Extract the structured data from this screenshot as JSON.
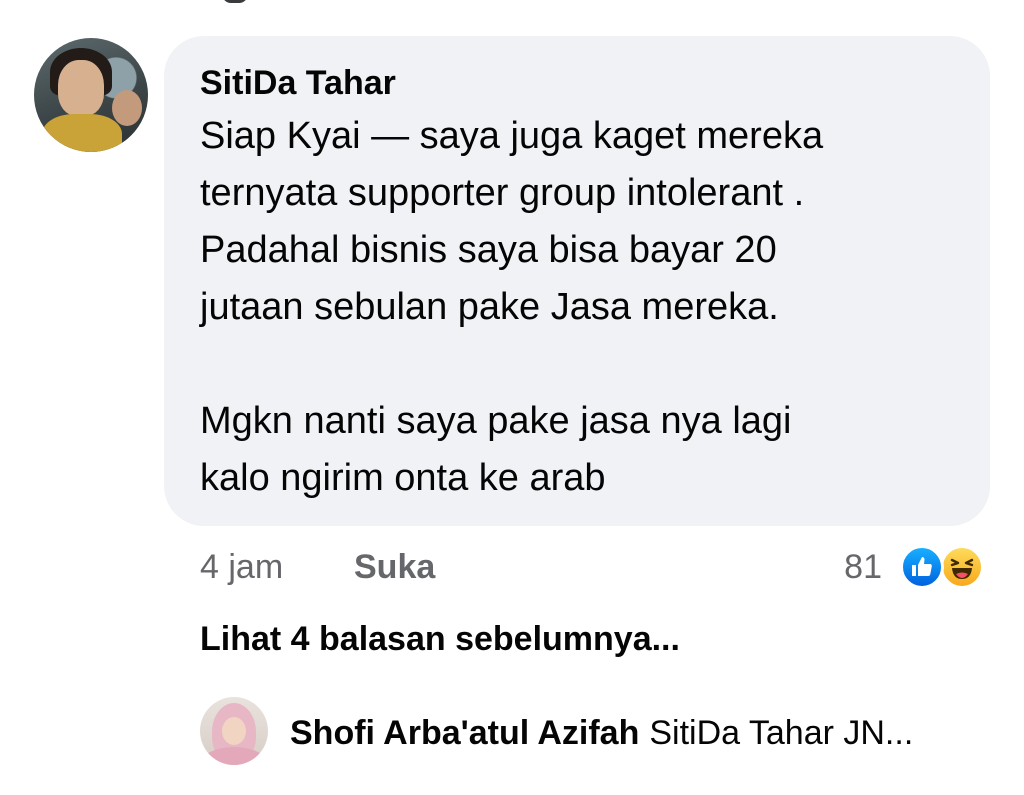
{
  "comment": {
    "author": "SitiDa Tahar",
    "text": "Siap Kyai — saya juga kaget mereka\nternyata supporter group intolerant .\nPadahal bisnis saya bisa bayar 20\njutaan sebulan pake Jasa mereka.\n\nMgkn nanti saya pake jasa nya lagi\nkalo ngirim onta ke arab",
    "time": "4 jam",
    "like_label": "Suka",
    "reaction_count": "81",
    "reaction_icons": [
      "like-icon",
      "haha-icon"
    ],
    "bubble_color": "#f0f2f5"
  },
  "replies": {
    "view_previous_label": "Lihat 4 balasan sebelumnya...",
    "latest": {
      "author": "Shofi Arba'atul Azifah",
      "snippet": "SitiDa Tahar JN..."
    }
  },
  "colors": {
    "meta_text": "#65676b",
    "like_blue": "#0866ff",
    "haha_yellow": "#f8c42a"
  }
}
